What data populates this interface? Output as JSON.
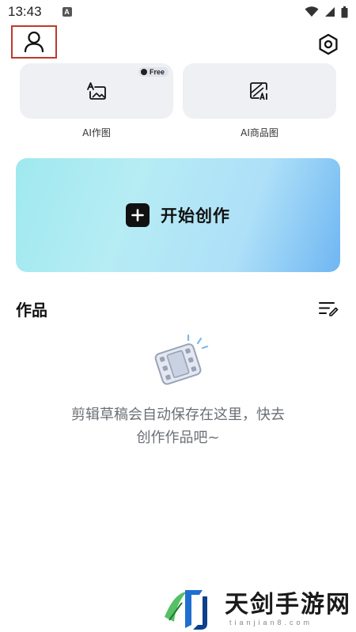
{
  "status_bar": {
    "time": "13:43",
    "a_icon_letter": "A",
    "icons": [
      "wifi-icon",
      "signal-icon",
      "battery-icon"
    ]
  },
  "header": {
    "profile_icon": "person-icon",
    "settings_icon": "settings-icon"
  },
  "tools": [
    {
      "label": "AI作图",
      "icon": "ai-image-icon",
      "badge": "Free"
    },
    {
      "label": "AI商品图",
      "icon": "ai-product-image-icon"
    }
  ],
  "start_create": {
    "label": "开始创作",
    "icon": "plus-icon"
  },
  "works": {
    "title": "作品",
    "edit_icon": "edit-list-icon"
  },
  "empty_state": {
    "illustration": "film-reel-icon",
    "line1": "剪辑草稿会自动保存在这里，快去",
    "line2": "创作作品吧~"
  },
  "watermark": {
    "title": "天剑手游网",
    "subtitle": "tianjian8.com"
  },
  "colors": {
    "accent_gradient_start": "#9fe9ef",
    "accent_gradient_end": "#6fb6f2",
    "card_bg": "#eef0f3",
    "highlight_box": "#c0392b"
  }
}
